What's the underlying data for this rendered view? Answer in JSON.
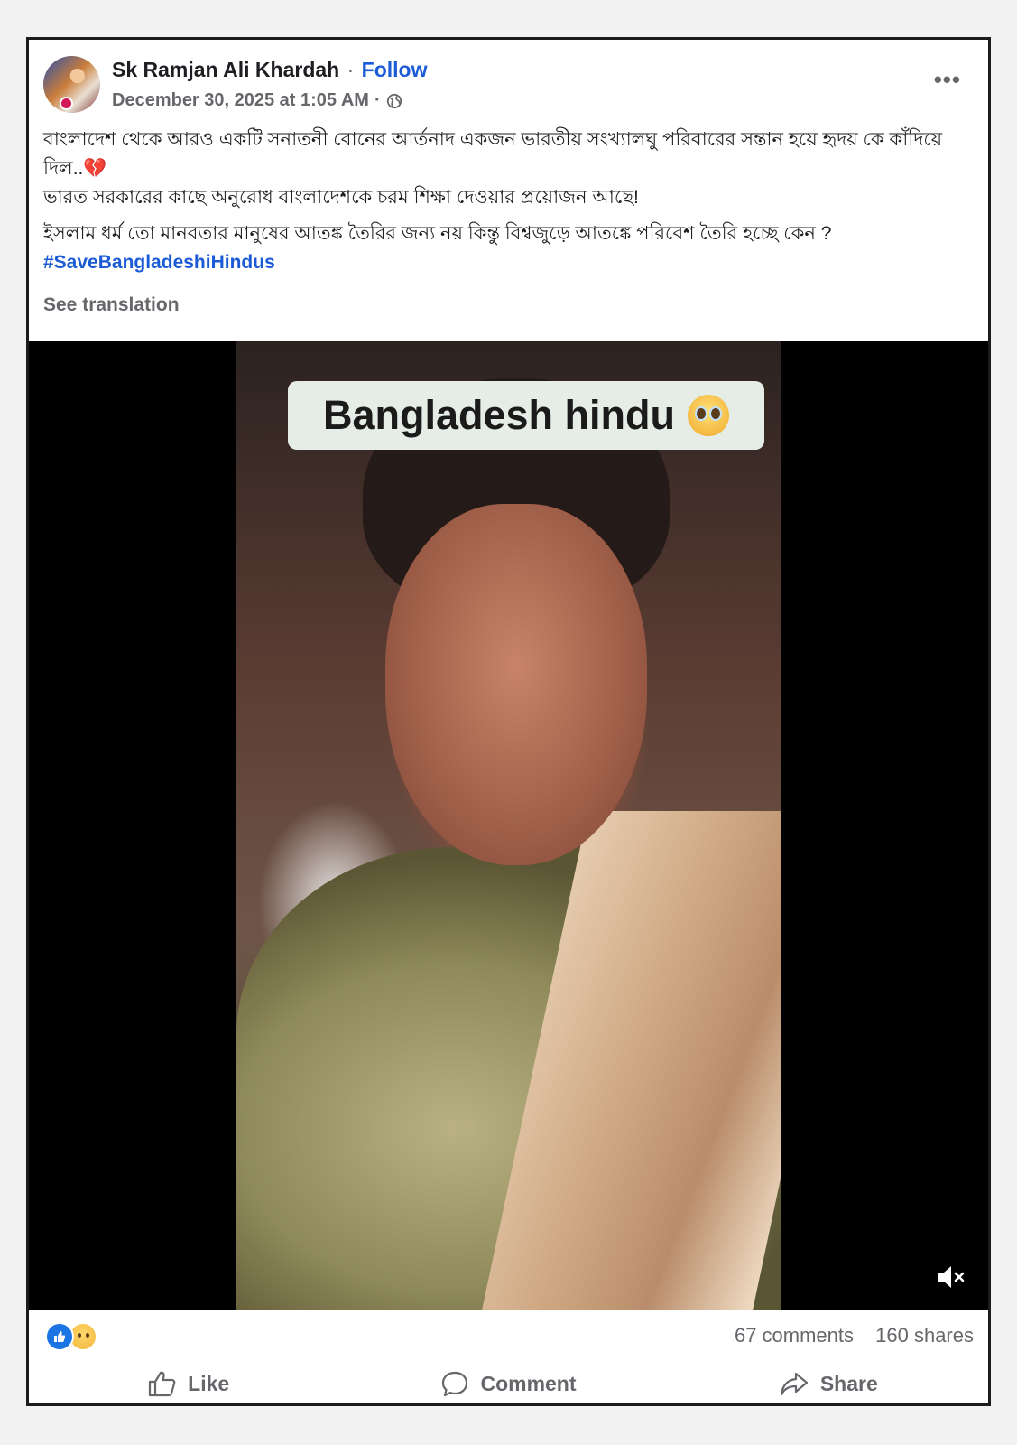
{
  "post": {
    "author": "Sk Ramjan Ali Khardah",
    "separator": "·",
    "follow_label": "Follow",
    "timestamp": "December 30, 2025 at 1:05 AM",
    "meta_separator": "·",
    "more_label": "•••",
    "text_line1": "বাংলাদেশ থেকে আরও একটি সনাতনী বোনের আর্তনাদ একজন ভারতীয় সংখ্যালঘু পরিবারের সন্তান হয়ে হৃদয় কে কাঁদিয়ে দিল..💔",
    "text_line2": "ভারত সরকারের কাছে অনুরোধ বাংলাদেশকে চরম শিক্ষা দেওয়ার প্রয়োজন আছে!",
    "text_line3": "ইসলাম ধর্ম তো মানবতার মানুষের আতঙ্ক তৈরির জন্য নয় কিন্তু বিশ্বজুড়ে আতঙ্কে পরিবেশ তৈরি হচ্ছে কেন ?",
    "hashtag": "#SaveBangladeshiHindus",
    "see_translation": "See translation"
  },
  "video": {
    "caption": "Bangladesh hindu",
    "caption_emoji": "crying-face-emoji",
    "mute_icon": "muted-speaker-icon"
  },
  "footer": {
    "reactions": [
      "like-reaction-icon",
      "sad-reaction-icon"
    ],
    "comments": "67 comments",
    "shares": "160 shares",
    "like_label": "Like",
    "comment_label": "Comment",
    "share_label": "Share"
  },
  "colors": {
    "link_blue": "#1b5bd6",
    "secondary_text": "#65676b",
    "like_blue": "#1b74e4"
  }
}
